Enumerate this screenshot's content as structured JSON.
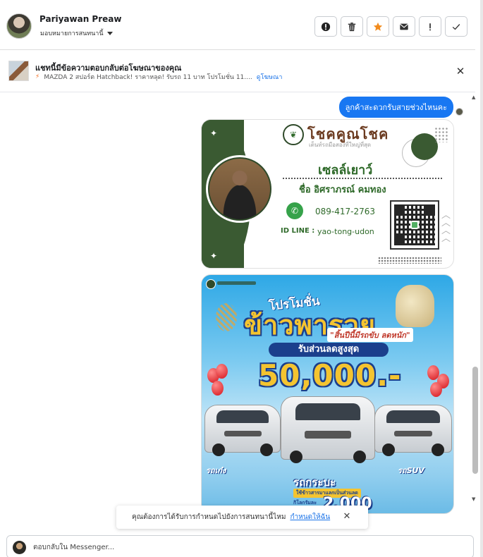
{
  "header": {
    "contact_name": "Pariyawan Preaw",
    "assign_label": "มอบหมายการสนทนานี้",
    "toolbar": [
      {
        "name": "spam-button",
        "icon": "alert-circle-icon"
      },
      {
        "name": "delete-button",
        "icon": "trash-icon"
      },
      {
        "name": "star-button",
        "icon": "star-icon"
      },
      {
        "name": "mark-unread-button",
        "icon": "envelope-icon"
      },
      {
        "name": "follow-up-button",
        "icon": "exclamation-icon"
      },
      {
        "name": "mark-done-button",
        "icon": "check-icon"
      }
    ],
    "colors": {
      "star": "#f28b1d"
    }
  },
  "adbar": {
    "title": "แชทนี้มีข้อความตอบกลับต่อโฆษณาของคุณ",
    "ad_text": "MAZDA 2 สปอร์ต Hatchback! ราคาหลุด! รับรถ 11 บาท โปรโมชั่น 11....",
    "view_ad": "ดูโฆษณา"
  },
  "chat": {
    "message": "ลูกค้าสะดวกรับสายช่วงไหนคะ",
    "card": {
      "brand": "โชคคูณโชค",
      "brand_sub": "เต็นท์รถมือสองที่ใหญ่ที่สุด",
      "sales_title": "เซลล์เยาว์",
      "sales_name": "ชื่อ อิศราภรณ์  คมทอง",
      "phone": "089-417-2763",
      "line_label": "ID LINE :",
      "line_id": "yao-tong-udon"
    },
    "promo": {
      "pre_title": "โปรโมชั่น",
      "title": "ข้าวพารวย",
      "tag": "\"สิ้นปีนี้มีรถขับ ลดหนัก\"",
      "discount_label": "รับส่วนลดสูงสุด",
      "amount": "50,000.-",
      "car_left": "รถเก๋ง",
      "car_right": "รถSUV",
      "truck_label": "รถกระบะ",
      "truck_sub": "ใช้ข้าวสารมาแลกเป็นส่วนลด",
      "truck_amount_label": "กิโลกรัมละ",
      "truck_amount": "2,000"
    },
    "colors": {
      "bubble": "#1877f2",
      "brand_green": "#3a5a32"
    }
  },
  "toast": {
    "text": "คุณต้องการได้รับการกำหนดไปยังการสนทนานี้ไหม",
    "link": "กำหนดให้ฉัน"
  },
  "composer": {
    "placeholder": "ตอบกลับใน Messenger..."
  }
}
